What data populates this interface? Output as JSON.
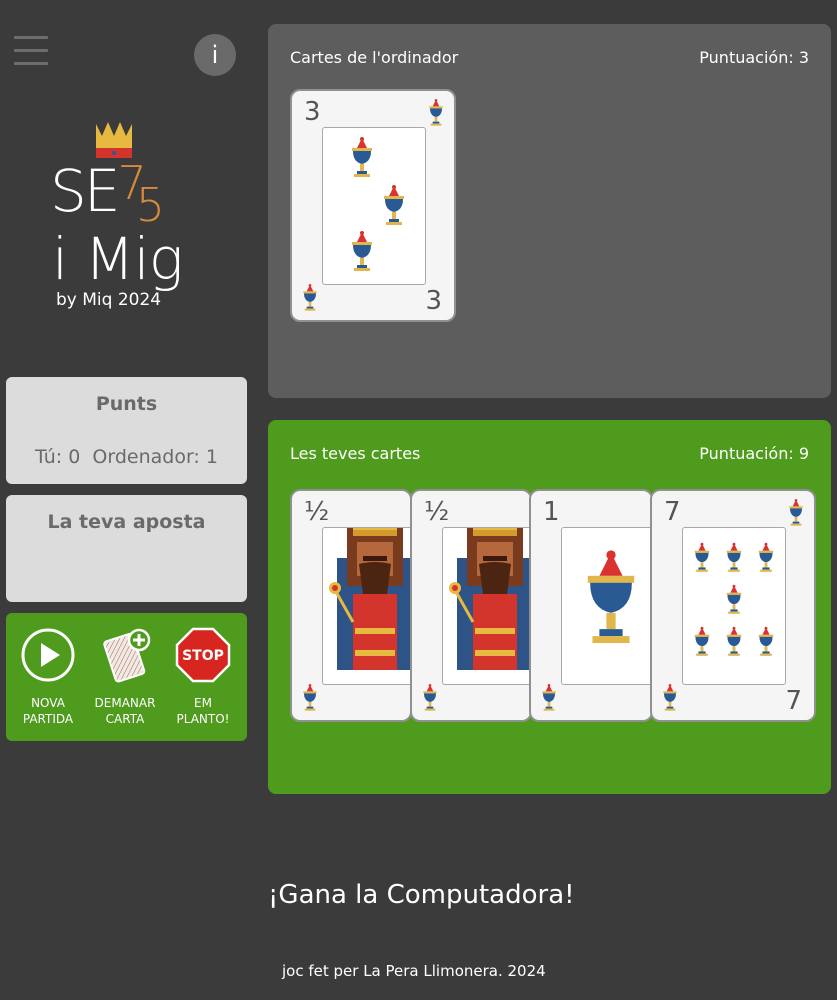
{
  "header": {
    "menu_icon": "hamburger-icon",
    "info_label": "i"
  },
  "logo": {
    "line1_a": "SE",
    "line1_b": "7",
    "line1_c": "5",
    "line2": "i Mig",
    "line3": "by Miq 2024",
    "crown_icon": "crown-icon"
  },
  "points_panel": {
    "title": "Punts",
    "scores": "Tú: 0  Ordenador: 1"
  },
  "bet_panel": {
    "title": "La teva aposta"
  },
  "actions": [
    {
      "label": "NOVA\nPARTIDA",
      "icon": "play-icon"
    },
    {
      "label": "DEMANAR\nCARTA",
      "icon": "draw-card-icon"
    },
    {
      "label": "EM\nPLANTO!",
      "icon": "stop-sign-icon",
      "sign_text": "STOP"
    }
  ],
  "computer_board": {
    "label": "Cartes de l'ordinador",
    "score": "Puntuación: 3",
    "cards": [
      {
        "rank": "3",
        "suit": "cups",
        "type": "number"
      }
    ]
  },
  "player_board": {
    "label": "Les teves cartes",
    "score": "Puntuación: 9",
    "cards": [
      {
        "rank": "½",
        "suit": "cups",
        "type": "king"
      },
      {
        "rank": "½",
        "suit": "cups",
        "type": "king"
      },
      {
        "rank": "1",
        "suit": "cups",
        "type": "ace"
      },
      {
        "rank": "7",
        "suit": "cups",
        "type": "number"
      }
    ]
  },
  "result": "¡Gana la Computadora!",
  "footer": "joc fet per La Pera Llimonera. 2024",
  "colors": {
    "background": "#3b3b3b",
    "green": "#4f9b1d",
    "orange": "#d78a3c",
    "computer_board": "#5d5d5d"
  }
}
